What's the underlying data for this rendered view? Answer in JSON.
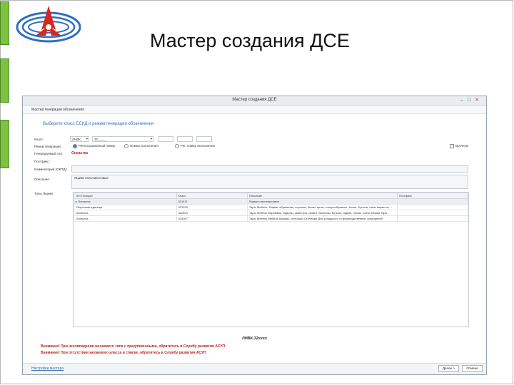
{
  "slide": {
    "title": "Мастер создания ДСЕ"
  },
  "window": {
    "title": "Мастер создания ДСЕ",
    "controls": {
      "minimize": "–",
      "maximize": "□",
      "close": "✕"
    },
    "menu_label": "Мастер генерации обозначения",
    "prompt": "Выберите класс ЕСКД и режим генерации обозначения",
    "form": {
      "class_label": "Класс:",
      "class_prefix": "ЛНВК",
      "class_code": "32 ____",
      "mode_label": "Режим генерации:",
      "mode_options": [
        "Регистрационный номер",
        "Номер исполнения",
        "Рег. номер исполнения"
      ],
      "mode_selected": 0,
      "checkbox_label": "Вручную",
      "type_label": "Генерируемый тип:",
      "type_value": "Оснастка",
      "postfix_label": "Постфикс:",
      "comment_label": "Комментарий (ОКПД):",
      "description_label": "Описание:",
      "description_value": "Ящики пластмассовые",
      "types_label": "Типы Ящики:"
    },
    "table": {
      "columns": [
        "Тип Позиции",
        "Класс",
        "Описание",
        "Постфикс"
      ],
      "rows": [
        {
          "marker": "▸",
          "type": "Оснастка",
          "class": "321411",
          "description": "Ящики пластмассовые",
          "postfix": ""
        },
        {
          "marker": "",
          "type": "Сборочная единица",
          "class": "321233",
          "description": "Тара. Мебель. Ящики, обрешетки, корзины, банки, цены, топорообразные, бочки, бутыли, чаны ящики из ...",
          "postfix": ""
        },
        {
          "marker": "",
          "type": "Оснастка",
          "class": "322453",
          "description": "Тара. Мебель Барабаны, бидоны, канистры, флаги, баллоны, бутыли, ящики, чехлы, слеги Мешки тара ...",
          "postfix": ""
        },
        {
          "marker": "",
          "type": "Оснастка",
          "class": "324097",
          "description": "Тара. Мебель Мебель Шкафы, стеллажи Стеллажи Для складского и производственных помещений",
          "postfix": ""
        }
      ]
    },
    "generated_code": "ЛНВК.32хххх",
    "warnings": [
      "Внимание! При несовпадении желаемого типа с предложенными, обратитесь в Службу развития АСУП",
      "Внимание! При отсутствии желаемого класса в списке, обратитесь в Службу развития АСУП"
    ],
    "footer": {
      "settings_link": "Настройки мастера",
      "next_button": "Далее >",
      "cancel_button": "Отмена"
    }
  },
  "colors": {
    "accent_green": "#7fc241",
    "link_blue": "#3b6fb3",
    "warning_red": "#c0211b"
  }
}
